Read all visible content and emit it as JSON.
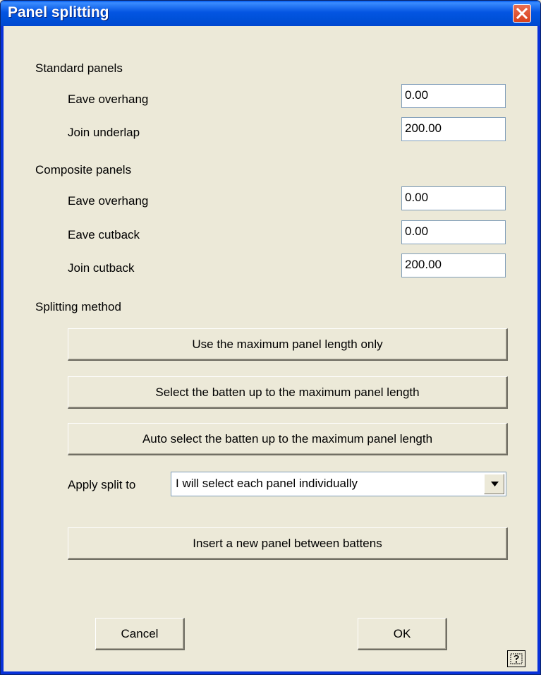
{
  "window": {
    "title": "Panel splitting"
  },
  "standard": {
    "heading": "Standard panels",
    "eave_overhang_label": "Eave overhang",
    "eave_overhang_value": "0.00",
    "join_underlap_label": "Join underlap",
    "join_underlap_value": "200.00"
  },
  "composite": {
    "heading": "Composite panels",
    "eave_overhang_label": "Eave overhang",
    "eave_overhang_value": "0.00",
    "eave_cutback_label": "Eave cutback",
    "eave_cutback_value": "0.00",
    "join_cutback_label": "Join cutback",
    "join_cutback_value": "200.00"
  },
  "splitting": {
    "heading": "Splitting method",
    "btn_max_length": "Use the maximum panel length only",
    "btn_select_batten": "Select the batten up to the maximum panel length",
    "btn_auto_select": "Auto select the batten up to the maximum panel length",
    "apply_label": "Apply split to",
    "apply_value": "I will select each panel individually",
    "btn_insert": "Insert a new panel between battens"
  },
  "footer": {
    "cancel": "Cancel",
    "ok": "OK"
  },
  "icons": {
    "close": "close-icon",
    "dropdown": "chevron-down-icon",
    "help": "help-icon"
  },
  "colors": {
    "titlebar": "#0054e3",
    "close": "#d8411d",
    "face": "#ece9d8"
  }
}
